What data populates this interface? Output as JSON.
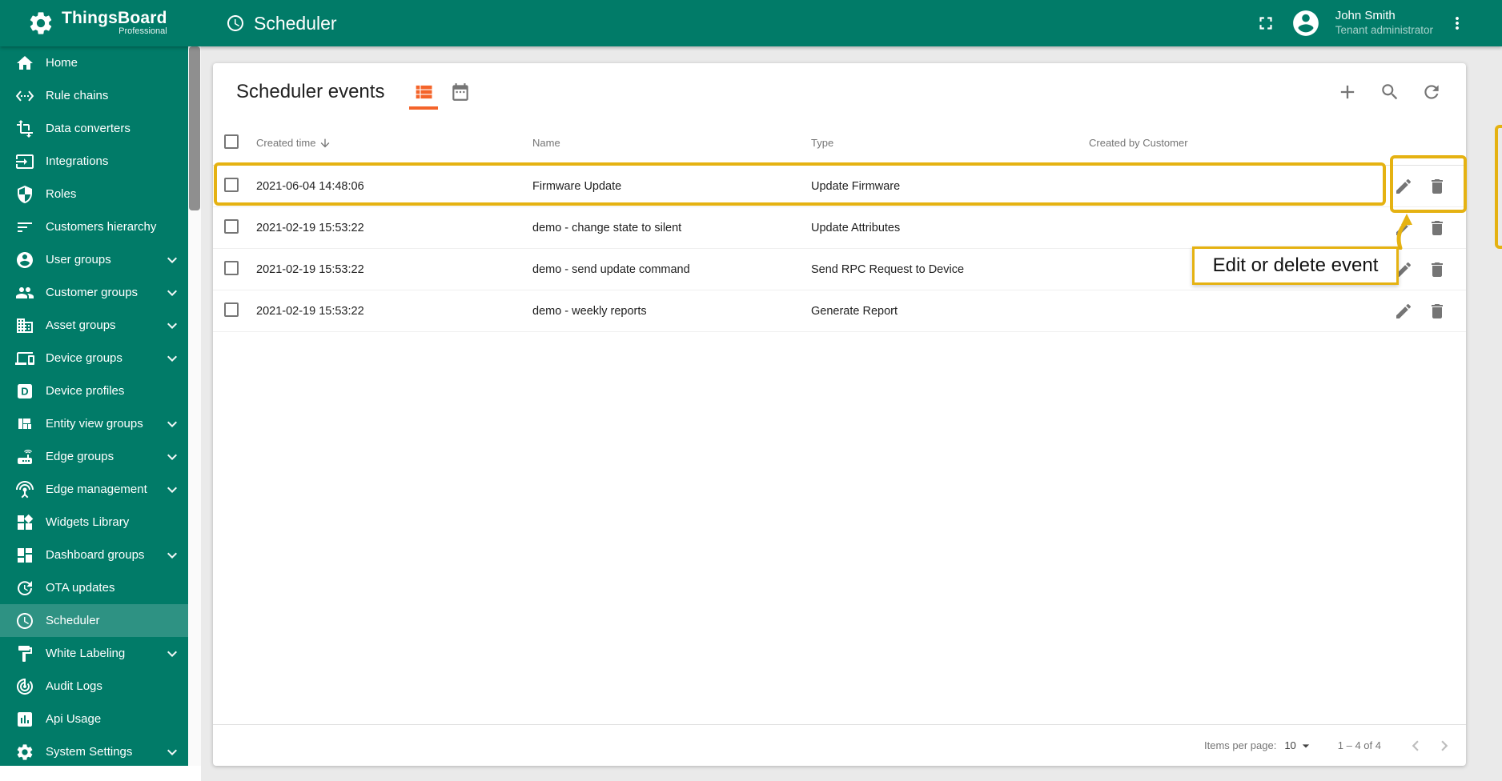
{
  "app": {
    "brand": "ThingsBoard",
    "brand_sub": "Professional",
    "page_title": "Scheduler",
    "user": {
      "name": "John Smith",
      "role": "Tenant administrator"
    }
  },
  "colors": {
    "sidebar_teal": "#017B68",
    "accent_orange": "#F4642A",
    "annotation_yellow": "#E5B212"
  },
  "sidebar": {
    "items": [
      {
        "label": "Home",
        "icon": "home"
      },
      {
        "label": "Rule chains",
        "icon": "rule-chains"
      },
      {
        "label": "Data converters",
        "icon": "data-converters"
      },
      {
        "label": "Integrations",
        "icon": "integrations"
      },
      {
        "label": "Roles",
        "icon": "roles"
      },
      {
        "label": "Customers hierarchy",
        "icon": "customers-hierarchy"
      },
      {
        "label": "User groups",
        "icon": "user-groups",
        "expandable": true
      },
      {
        "label": "Customer groups",
        "icon": "customer-groups",
        "expandable": true
      },
      {
        "label": "Asset groups",
        "icon": "asset-groups",
        "expandable": true
      },
      {
        "label": "Device groups",
        "icon": "device-groups",
        "expandable": true
      },
      {
        "label": "Device profiles",
        "icon": "device-profiles"
      },
      {
        "label": "Entity view groups",
        "icon": "entity-view-groups",
        "expandable": true
      },
      {
        "label": "Edge groups",
        "icon": "edge-groups",
        "expandable": true
      },
      {
        "label": "Edge management",
        "icon": "edge-management",
        "expandable": true
      },
      {
        "label": "Widgets Library",
        "icon": "widgets-library"
      },
      {
        "label": "Dashboard groups",
        "icon": "dashboard-groups",
        "expandable": true
      },
      {
        "label": "OTA updates",
        "icon": "ota-updates"
      },
      {
        "label": "Scheduler",
        "icon": "scheduler",
        "selected": true
      },
      {
        "label": "White Labeling",
        "icon": "white-labeling",
        "expandable": true
      },
      {
        "label": "Audit Logs",
        "icon": "audit-logs"
      },
      {
        "label": "Api Usage",
        "icon": "api-usage"
      },
      {
        "label": "System Settings",
        "icon": "system-settings",
        "expandable": true
      }
    ]
  },
  "main": {
    "card_title": "Scheduler events",
    "toolbar_icons": [
      "add",
      "search",
      "refresh"
    ],
    "view_toggles": [
      "list-view",
      "calendar-view"
    ],
    "table": {
      "columns": [
        "Created time",
        "Name",
        "Type",
        "Created by Customer"
      ],
      "sort_column": "Created time",
      "sort_direction": "desc",
      "rows": [
        {
          "created": "2021-06-04 14:48:06",
          "name": "Firmware Update",
          "type": "Update Firmware",
          "customer": ""
        },
        {
          "created": "2021-02-19 15:53:22",
          "name": "demo - change state to silent",
          "type": "Update Attributes",
          "customer": ""
        },
        {
          "created": "2021-02-19 15:53:22",
          "name": "demo - send update command",
          "type": "Send RPC Request to Device",
          "customer": ""
        },
        {
          "created": "2021-02-19 15:53:22",
          "name": "demo - weekly reports",
          "type": "Generate Report",
          "customer": ""
        }
      ],
      "row_actions": [
        "edit",
        "delete"
      ]
    },
    "pagination": {
      "items_per_page_label": "Items per page:",
      "items_per_page": "10",
      "range": "1 – 4 of 4"
    }
  },
  "annotation": {
    "tooltip": "Edit or delete event",
    "highlighted_row": "Firmware Update"
  }
}
